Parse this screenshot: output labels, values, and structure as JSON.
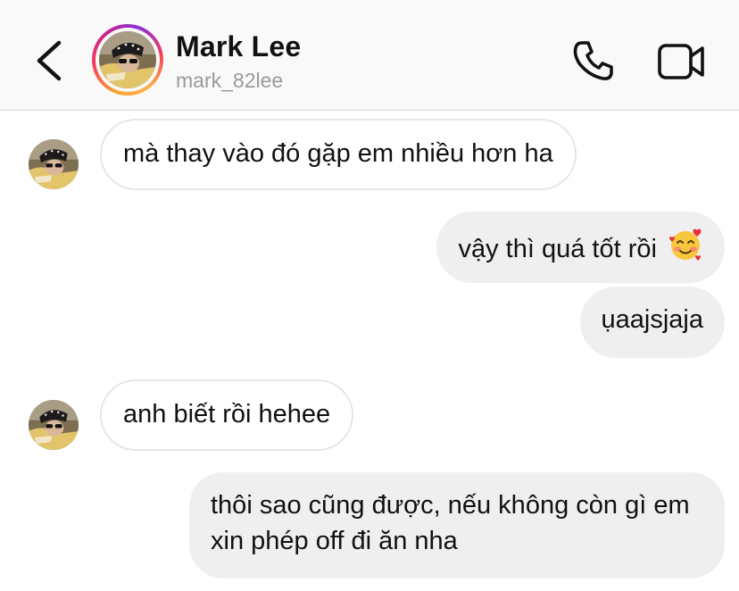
{
  "header": {
    "name": "Mark Lee",
    "username": "mark_82lee"
  },
  "messages": [
    {
      "sender": "them",
      "text": "mà thay vào đó gặp em nhiều hơn ha"
    },
    {
      "sender": "me",
      "text": "vậy thì quá tốt rồi",
      "emoji": "smiling-face-with-hearts"
    },
    {
      "sender": "me",
      "text": "ụaajsjaja"
    },
    {
      "sender": "them",
      "text": "anh biết rồi hehee"
    },
    {
      "sender": "me",
      "text": "thôi sao cũng được, nếu không còn gì em xin phép off đi ăn nha"
    }
  ],
  "icons": [
    "back-chevron-icon",
    "phone-icon",
    "video-camera-icon"
  ]
}
